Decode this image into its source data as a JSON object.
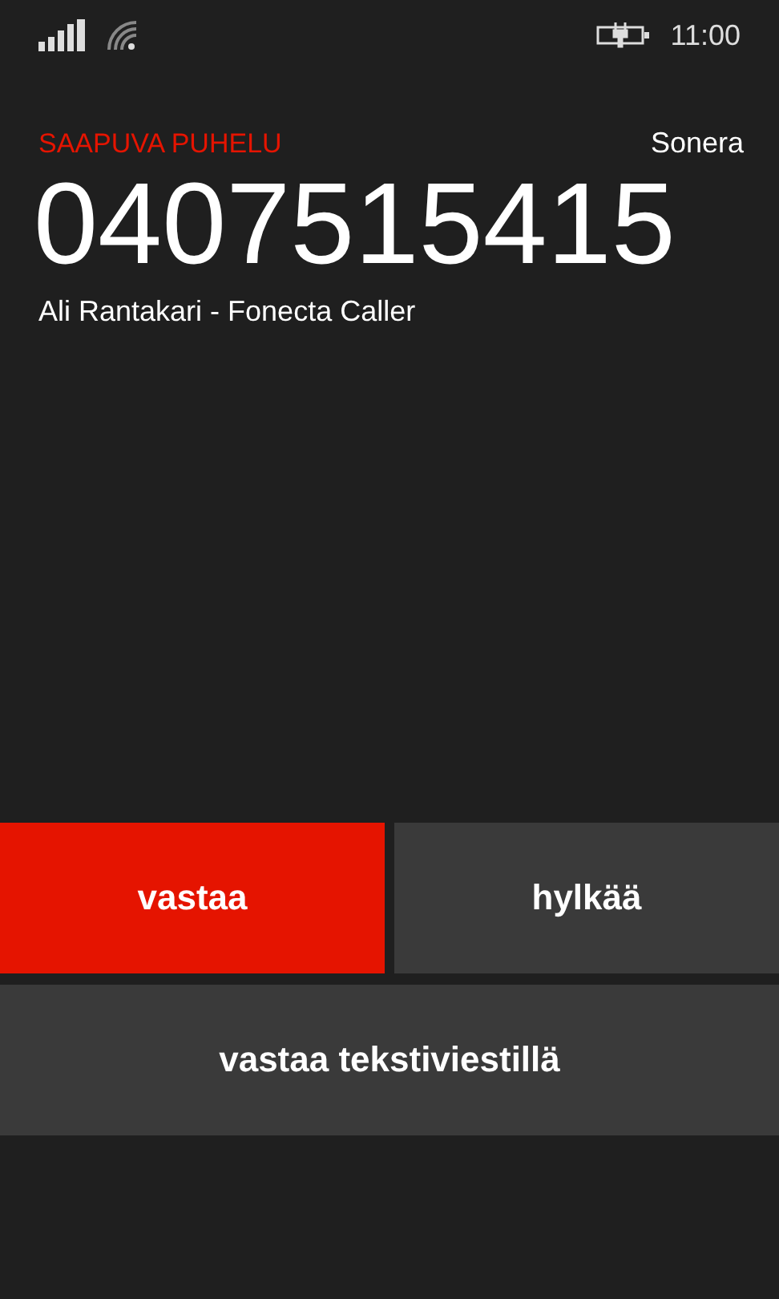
{
  "status_bar": {
    "time": "11:00"
  },
  "call": {
    "label": "SAAPUVA PUHELU",
    "operator": "Sonera",
    "number": "0407515415",
    "caller": "Ali Rantakari - Fonecta Caller"
  },
  "actions": [
    {
      "label": "vastaa",
      "kind": "primary"
    },
    {
      "label": "hylkää",
      "kind": "secondary"
    },
    {
      "label": "vastaa tekstiviestillä",
      "kind": "secondary"
    }
  ]
}
